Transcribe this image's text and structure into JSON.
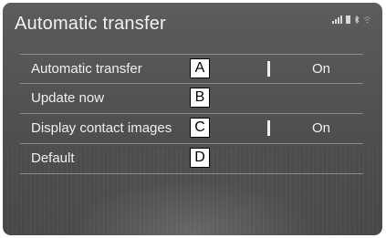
{
  "header": {
    "title": "Automatic transfer"
  },
  "status_bar": {
    "icons": [
      "signal-icon",
      "battery-icon",
      "bluetooth-icon",
      "wifi-icon"
    ]
  },
  "settings": [
    {
      "label": "Automatic transfer",
      "callout": "A",
      "value": "On"
    },
    {
      "label": "Update now",
      "callout": "B",
      "value": ""
    },
    {
      "label": "Display contact images",
      "callout": "C",
      "value": "On"
    },
    {
      "label": "Default",
      "callout": "D",
      "value": ""
    }
  ]
}
